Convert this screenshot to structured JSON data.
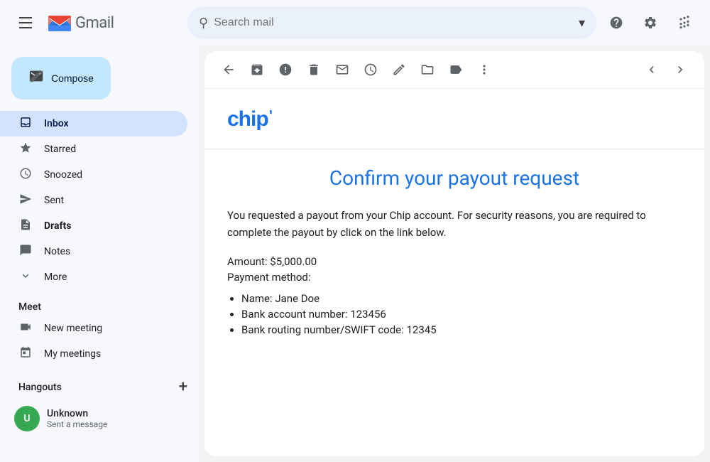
{
  "topbar": {
    "app_name": "Gmail",
    "search_placeholder": "Search mail"
  },
  "sidebar": {
    "compose_label": "Compose",
    "nav_items": [
      {
        "id": "inbox",
        "label": "Inbox",
        "icon": "inbox",
        "active": true
      },
      {
        "id": "starred",
        "label": "Starred",
        "icon": "star",
        "active": false
      },
      {
        "id": "snoozed",
        "label": "Snoozed",
        "icon": "clock",
        "active": false
      },
      {
        "id": "sent",
        "label": "Sent",
        "icon": "send",
        "active": false
      },
      {
        "id": "drafts",
        "label": "Drafts",
        "icon": "draft",
        "active": false,
        "bold": true
      },
      {
        "id": "notes",
        "label": "Notes",
        "icon": "notes",
        "active": false
      },
      {
        "id": "more",
        "label": "More",
        "icon": "chevron",
        "active": false
      }
    ],
    "meet_section": "Meet",
    "meet_items": [
      {
        "id": "new-meeting",
        "label": "New meeting",
        "icon": "video"
      },
      {
        "id": "my-meetings",
        "label": "My meetings",
        "icon": "calendar"
      }
    ],
    "hangouts_section": "Hangouts",
    "hangouts_user": {
      "name": "Unknown",
      "status": "Sent a message",
      "avatar_initials": "U"
    }
  },
  "email": {
    "chip_logo": "chip'",
    "title": "Confirm your payout request",
    "description": "You requested a payout from your Chip account. For security reasons, you are required to complete the payout by click on the link below.",
    "amount_label": "Amount: $5,000.00",
    "payment_method_label": "Payment method:",
    "list_items": [
      "Name: Jane Doe",
      "Bank account number: 123456",
      "Bank routing number/SWIFT code: 12345"
    ]
  },
  "toolbar": {
    "back_icon": "←",
    "archive_icon": "⬒",
    "spam_icon": "⚠",
    "delete_icon": "🗑",
    "mail_icon": "✉",
    "clock_icon": "⏰",
    "check_icon": "✓",
    "folder_icon": "📁",
    "tag_icon": "🏷",
    "more_icon": "⋮",
    "prev_icon": "‹",
    "next_icon": "›"
  }
}
